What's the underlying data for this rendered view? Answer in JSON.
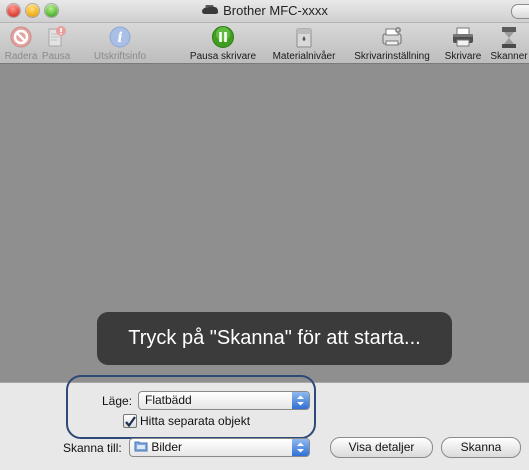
{
  "window": {
    "title": "Brother MFC-xxxx"
  },
  "toolbar": {
    "items": [
      {
        "label": "Radera",
        "icon": "delete-icon",
        "enabled": false
      },
      {
        "label": "Pausa",
        "icon": "pause-job-icon",
        "enabled": false
      },
      {
        "label": "Utskriftsinfo",
        "icon": "info-icon",
        "enabled": false
      },
      {
        "label": "Pausa skrivare",
        "icon": "pause-printer-icon",
        "enabled": true
      },
      {
        "label": "Materialnivåer",
        "icon": "supply-levels-icon",
        "enabled": true
      },
      {
        "label": "Skrivarinställning",
        "icon": "printer-setup-icon",
        "enabled": true
      },
      {
        "label": "Skrivare",
        "icon": "printer-icon",
        "enabled": true
      },
      {
        "label": "Skanner",
        "icon": "scanner-icon",
        "enabled": true
      }
    ]
  },
  "preview": {
    "message": "Tryck på \"Skanna\" för att starta..."
  },
  "settings": {
    "mode_label": "Läge:",
    "mode_value": "Flatbädd",
    "detect_separate_label": "Hitta separata objekt",
    "detect_separate_checked": true,
    "scan_to_label": "Skanna till:",
    "scan_to_value": "Bilder"
  },
  "buttons": {
    "show_details": "Visa detaljer",
    "scan": "Skanna"
  },
  "colors": {
    "preview_bg": "#8f8f8f",
    "hud_bg": "#3b3b3b",
    "highlight_border": "#2e4a78",
    "pause_green": "#3f9e22"
  }
}
